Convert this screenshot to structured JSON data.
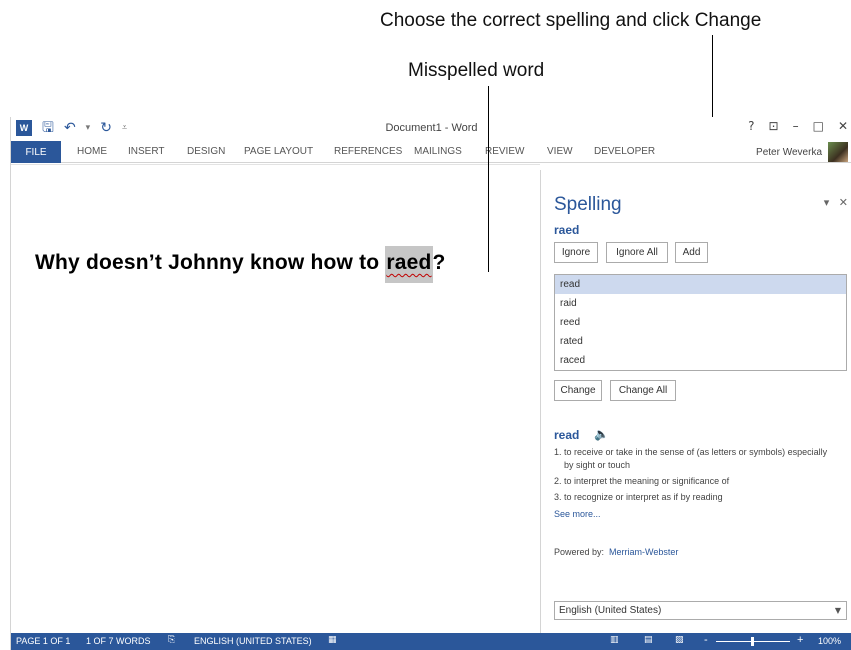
{
  "callouts": {
    "top": "Choose the correct spelling and click Change",
    "second": "Misspelled word"
  },
  "window": {
    "title": "Document1 - Word",
    "qat_icons": [
      "word-logo",
      "save-icon",
      "undo-icon",
      "redo-icon",
      "customize-icon"
    ],
    "controls": [
      "?",
      "⊡",
      "–",
      "□",
      "✕"
    ]
  },
  "ribbon": {
    "tabs": [
      "FILE",
      "HOME",
      "INSERT",
      "DESIGN",
      "PAGE LAYOUT",
      "REFERENCES",
      "MAILINGS",
      "REVIEW",
      "VIEW",
      "DEVELOPER"
    ],
    "user": "Peter Weverka"
  },
  "document": {
    "text_before": "Why doesn’t Johnny know how to ",
    "misspelled": "raed",
    "text_after": "?"
  },
  "pane": {
    "title": "Spelling",
    "word": "raed",
    "buttons": {
      "ignore": "Ignore",
      "ignore_all": "Ignore All",
      "add": "Add",
      "change": "Change",
      "change_all": "Change All"
    },
    "suggestions": [
      "read",
      "raid",
      "reed",
      "rated",
      "raced"
    ],
    "selected_suggestion": "read",
    "definition_word": "read",
    "definitions": [
      "1. to receive or take in the sense of (as letters or symbols) especially by sight or touch",
      "2. to interpret the meaning or significance of",
      "3. to recognize or interpret as if by reading"
    ],
    "see_more": "See more...",
    "powered_by": "Powered by:",
    "dictionary": "Merriam-Webster",
    "language": "English (United States)"
  },
  "status": {
    "page": "PAGE 1 OF 1",
    "words": "1 OF 7 WORDS",
    "language": "ENGLISH (UNITED STATES)",
    "zoom": "100%",
    "zoom_minus": "-",
    "zoom_plus": "+"
  },
  "colors": {
    "accent": "#2b579a",
    "selection": "#cdd9ee",
    "misspelled_highlight": "#c6c6c6"
  }
}
